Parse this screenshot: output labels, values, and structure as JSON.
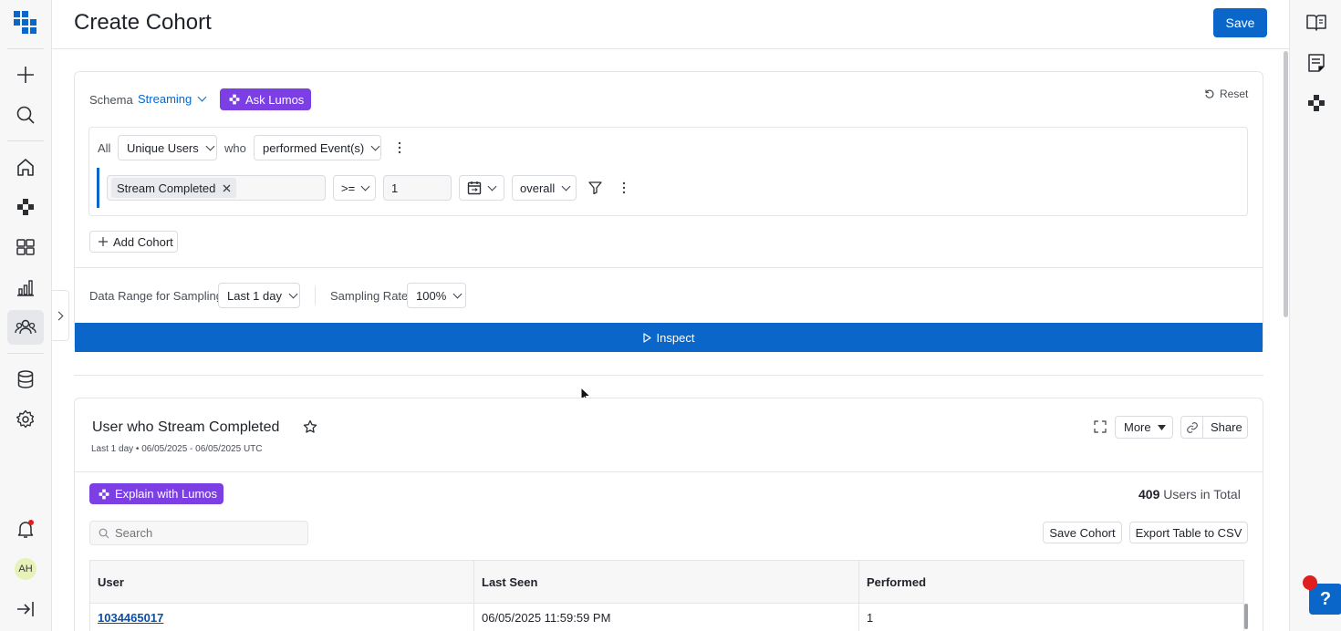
{
  "header": {
    "title": "Create Cohort",
    "save_label": "Save"
  },
  "nav": {
    "items": [
      "add-icon",
      "search-icon",
      "home-icon",
      "lumos-icon",
      "dashboard-icon",
      "chart-icon",
      "cohort-icon",
      "database-icon",
      "settings-icon",
      "bell-icon",
      "avatar",
      "collapse-icon"
    ],
    "avatar_initials": "AH"
  },
  "rightrail": {
    "items": [
      "book-icon",
      "notes-icon",
      "lumos-icon"
    ]
  },
  "query": {
    "schema_label": "Schema",
    "schema_value": "Streaming",
    "ask_lumos_label": "Ask Lumos",
    "reset_label": "Reset",
    "all_label": "All",
    "users_select": "Unique Users",
    "who_label": "who",
    "performed_select": "performed Event(s)",
    "event_chip": "Stream Completed",
    "operator_select": ">=",
    "count_value": "1",
    "scope_select": "overall",
    "add_cohort_label": "Add Cohort",
    "data_range_label": "Data Range for Sampling",
    "data_range_value": "Last 1 day",
    "sampling_rate_label": "Sampling Rate",
    "sampling_rate_value": "100%",
    "inspect_label": "Inspect"
  },
  "results": {
    "title": "User who Stream Completed",
    "subtitle": "Last 1 day • 06/05/2025 - 06/05/2025 UTC",
    "more_label": "More",
    "share_label": "Share",
    "explain_label": "Explain with Lumos",
    "total_count": "409",
    "total_suffix": " Users in Total",
    "search_placeholder": "Search",
    "save_cohort_label": "Save Cohort",
    "export_label": "Export Table to CSV",
    "columns": [
      "User",
      "Last Seen",
      "Performed"
    ],
    "rows": [
      {
        "user": "1034465017",
        "last_seen": "06/05/2025 11:59:59 PM",
        "performed": "1"
      }
    ]
  },
  "colors": {
    "primary": "#0a66c8",
    "lumos": "#7b3fe4",
    "notify": "#e01e1e"
  },
  "help_label": "?"
}
